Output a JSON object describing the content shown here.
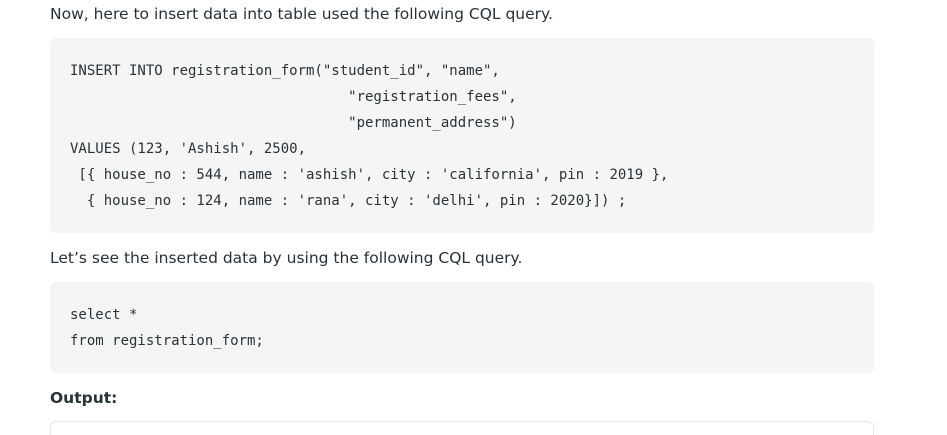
{
  "intro_text": "Now, here to insert data into table used the following CQL query.",
  "insert_code": {
    "lines": [
      "INSERT INTO registration_form(\"student_id\", \"name\",",
      "                                 \"registration_fees\",",
      "                                 \"permanent_address\")",
      "VALUES (123, 'Ashish', 2500,",
      " [{ house_no : 544, name : 'ashish', city : 'california', pin : 2019 },",
      "  { house_no : 124, name : 'rana', city : 'delhi', pin : 2020}]) ;"
    ]
  },
  "select_intro_text": "Let’s see the inserted data by using the following CQL query.",
  "select_code": {
    "lines": [
      "select *",
      "from registration_form;"
    ]
  },
  "output_heading": "Output:"
}
